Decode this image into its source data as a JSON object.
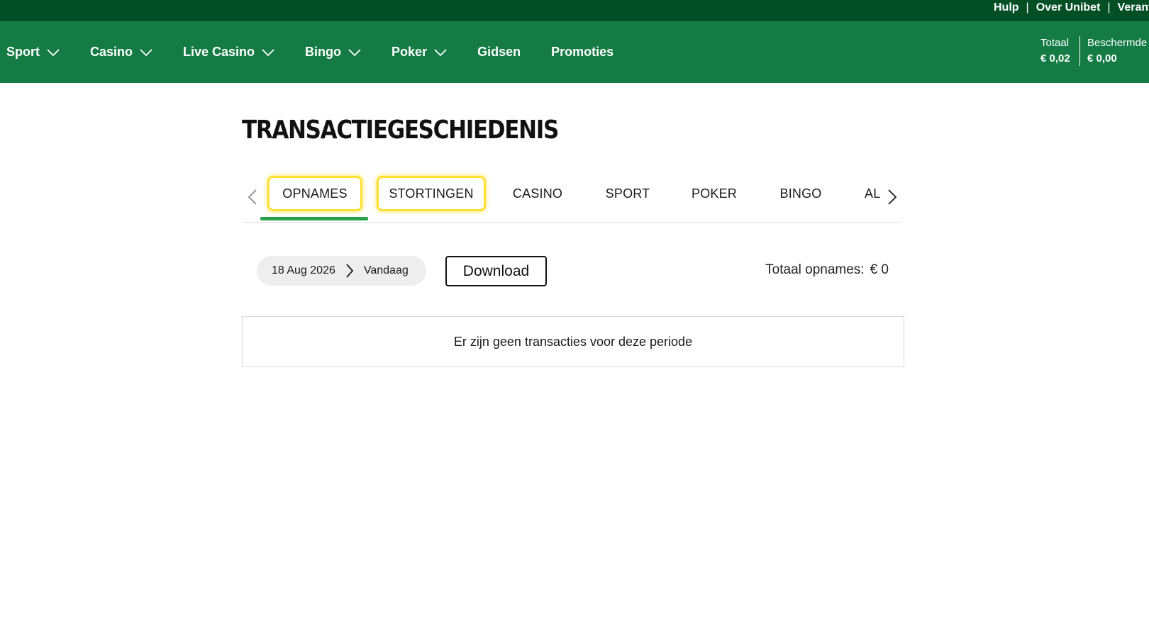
{
  "topbar": {
    "links": [
      "Hulp",
      "Over Unibet",
      "Verantw"
    ],
    "separator": "|"
  },
  "nav": {
    "items": [
      {
        "label": "Sport",
        "has_dropdown": true
      },
      {
        "label": "Casino",
        "has_dropdown": true
      },
      {
        "label": "Live Casino",
        "has_dropdown": true
      },
      {
        "label": "Bingo",
        "has_dropdown": true
      },
      {
        "label": "Poker",
        "has_dropdown": true
      },
      {
        "label": "Gidsen",
        "has_dropdown": false
      },
      {
        "label": "Promoties",
        "has_dropdown": false
      }
    ],
    "balance_total": {
      "label": "Totaal",
      "value": "€ 0,02"
    },
    "balance_protected": {
      "label": "Beschermde",
      "value": "€ 0,00"
    }
  },
  "page": {
    "title": "TRANSACTIEGESCHIEDENIS"
  },
  "tabs": {
    "items": [
      "OPNAMES",
      "STORTINGEN",
      "CASINO",
      "SPORT",
      "POKER",
      "BINGO",
      "AL"
    ],
    "active": "OPNAMES",
    "highlighted": [
      "OPNAMES",
      "STORTINGEN"
    ]
  },
  "filters": {
    "date_from": "18 Aug 2026",
    "date_to": "Vandaag",
    "download_label": "Download",
    "total_label": "Totaal opnames:",
    "total_value": "€ 0"
  },
  "results": {
    "empty_message": "Er zijn geen transacties voor deze periode"
  },
  "colors": {
    "topbar": "#024f25",
    "nav": "#147b45",
    "active_underline": "#2aa24a",
    "highlight": "#ffe033"
  },
  "icons": {
    "nav_dropdown": "chevron-down-icon",
    "tabs_prev": "chevron-left-icon",
    "tabs_next": "chevron-right-icon",
    "date_separator": "chevron-right-icon"
  }
}
